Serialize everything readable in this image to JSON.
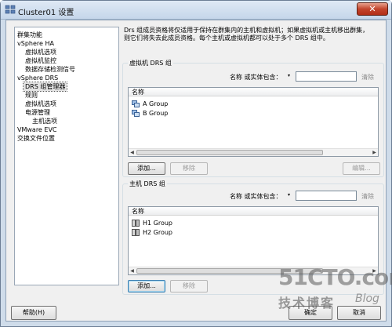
{
  "window": {
    "title": "Cluster01 设置",
    "close_glyph": "✕"
  },
  "nav": {
    "items": [
      {
        "label": "群集功能",
        "level": 0
      },
      {
        "label": "vSphere HA",
        "level": 0
      },
      {
        "label": "虚拟机选项",
        "level": 1
      },
      {
        "label": "虚拟机监控",
        "level": 1
      },
      {
        "label": "数据存储检测信号",
        "level": 1
      },
      {
        "label": "vSphere DRS",
        "level": 0
      },
      {
        "label": "DRS 组管理器",
        "level": 1,
        "selected": true
      },
      {
        "label": "规则",
        "level": 1
      },
      {
        "label": "虚拟机选项",
        "level": 1
      },
      {
        "label": "电源管理",
        "level": 1
      },
      {
        "label": "主机选项",
        "level": 2
      },
      {
        "label": "VMware EVC",
        "level": 0
      },
      {
        "label": "交换文件位置",
        "level": 0
      }
    ]
  },
  "description": {
    "line1": "Drs 组成员资格将仅适用于保持在群集内的主机和虚拟机；如果虚拟机或主机移出群集，",
    "line2": "则它们将失去此成员资格。每个主机或虚拟机都可以处于多个 DRS 组中。"
  },
  "vm_group": {
    "title": "虚拟机 DRS 组",
    "filter_label": "名称 或实体包含：",
    "filter_value": "",
    "clear_label": "清除",
    "column_header": "名称",
    "rows": [
      "A Group",
      "B Group"
    ],
    "add_label": "添加...",
    "remove_label": "移除",
    "edit_label": "编辑..."
  },
  "host_group": {
    "title": "主机 DRS 组",
    "filter_label": "名称 或实体包含：",
    "filter_value": "",
    "clear_label": "清除",
    "column_header": "名称",
    "rows": [
      "H1 Group",
      "H2 Group"
    ],
    "add_label": "添加...",
    "remove_label": "移除"
  },
  "footer": {
    "help_label": "帮助(H)",
    "ok_label": "确定",
    "cancel_label": "取消"
  },
  "watermark": {
    "line1": "51CTO.com",
    "line2": "技术博客",
    "line3": "Blog"
  },
  "colors": {
    "title_bar": "#c5d6ea",
    "close_button": "#c2452d",
    "dialog_bg": "#f0f0f0"
  }
}
